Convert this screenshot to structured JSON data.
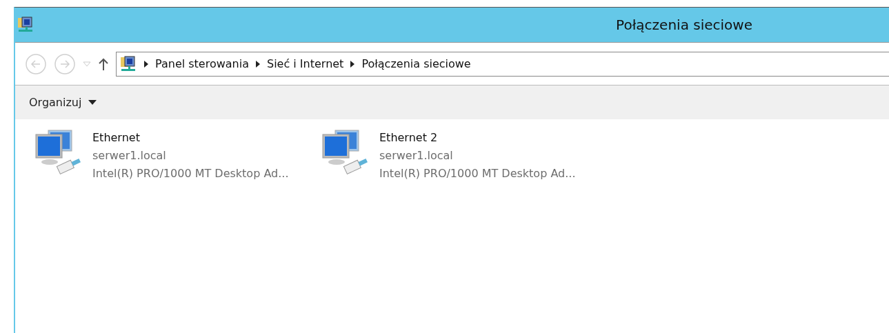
{
  "window": {
    "title": "Połączenia sieciowe"
  },
  "navigation": {
    "back": {
      "disabled": true
    },
    "forward": {
      "disabled": true
    }
  },
  "address_bar": {
    "crumbs": [
      "Panel sterowania",
      "Sieć i Internet",
      "Połączenia sieciowe"
    ]
  },
  "toolbar": {
    "buttons": [
      "Organizuj"
    ]
  },
  "connections": [
    {
      "name": "Ethernet",
      "network": "serwer1.local",
      "adapter": "Intel(R) PRO/1000 MT Desktop Ad..."
    },
    {
      "name": "Ethernet 2",
      "network": "serwer1.local",
      "adapter": "Intel(R) PRO/1000 MT Desktop Ad..."
    }
  ]
}
